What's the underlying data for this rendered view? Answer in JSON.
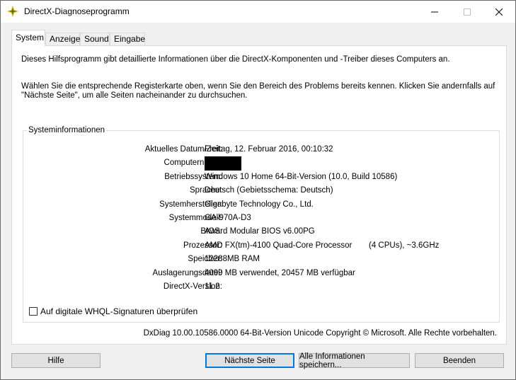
{
  "window": {
    "title": "DirectX-Diagnoseprogramm",
    "controls": {
      "minimize": "minimize-icon",
      "maximize": "maximize-icon",
      "close": "close-icon"
    }
  },
  "tabs": [
    {
      "label": "System",
      "active": true
    },
    {
      "label": "Anzeige",
      "active": false
    },
    {
      "label": "Sound",
      "active": false
    },
    {
      "label": "Eingabe",
      "active": false
    }
  ],
  "intro": {
    "line1": "Dieses Hilfsprogramm gibt detaillierte Informationen über die DirectX-Komponenten und -Treiber dieses Computers an.",
    "line2": "Wählen Sie die entsprechende Registerkarte oben, wenn Sie den Bereich des Problems bereits kennen. Klicken Sie andernfalls auf \"Nächste Seite\", um alle Seiten nacheinander zu durchsuchen."
  },
  "system_info": {
    "title": "Systeminformationen",
    "rows": [
      {
        "label": "Aktuelles Datum/Zeit:",
        "value": "Freitag, 12. Februar 2016, 00:10:32"
      },
      {
        "label": "Computername:",
        "value": ""
      },
      {
        "label": "Betriebssystem:",
        "value": "Windows 10 Home 64-Bit-Version (10.0, Build 10586)"
      },
      {
        "label": "Sprache:",
        "value": "Deutsch (Gebietsschema: Deutsch)"
      },
      {
        "label": "Systemhersteller:",
        "value": "Gigabyte Technology Co., Ltd."
      },
      {
        "label": "Systemmodell:",
        "value": "GA-970A-D3"
      },
      {
        "label": "BIOS:",
        "value": "Award Modular BIOS v6.00PG"
      },
      {
        "label": "Prozessor:",
        "value": "AMD FX(tm)-4100 Quad-Core Processor",
        "extra": "(4 CPUs), ~3.6GHz"
      },
      {
        "label": "Speicher:",
        "value": "12288MB RAM"
      },
      {
        "label": "Auslagerungsdatei:",
        "value": "4099 MB verwendet, 20457 MB verfügbar"
      },
      {
        "label": "DirectX-Version:",
        "value": "11.2"
      }
    ],
    "checkbox_label": "Auf digitale WHQL-Signaturen überprüfen",
    "checkbox_checked": false
  },
  "copyright": "DxDiag 10.00.10586.0000 64-Bit-Version Unicode Copyright © Microsoft. Alle Rechte vorbehalten.",
  "buttons": {
    "help": "Hilfe",
    "next": "Nächste Seite",
    "save": "Alle Informationen speichern...",
    "exit": "Beenden"
  }
}
